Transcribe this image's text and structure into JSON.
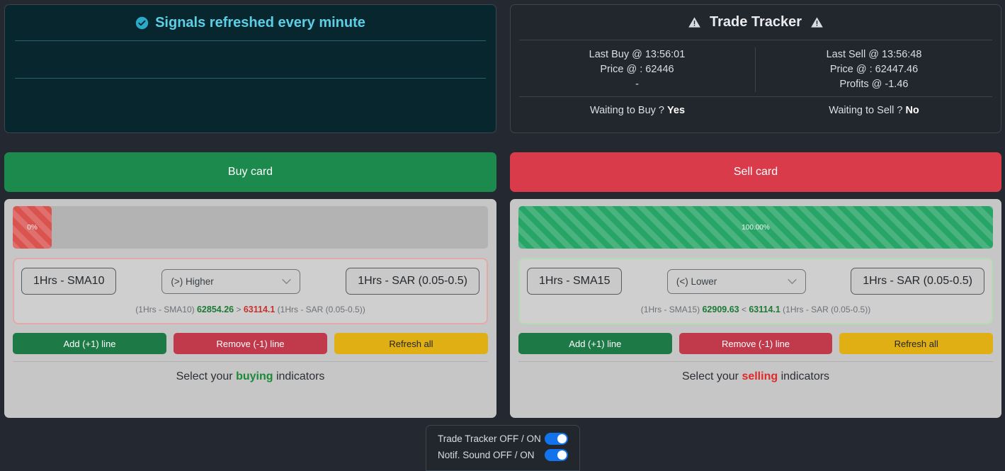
{
  "info_card": {
    "icon": "check-circle-icon",
    "title": "Signals refreshed every minute"
  },
  "trade_tracker": {
    "icon_left": "warning-triangle-icon",
    "icon_right": "warning-triangle-icon",
    "title": "Trade Tracker",
    "buy": {
      "last": "Last Buy @ 13:56:01",
      "price": "Price @ : 62446",
      "profits": "-",
      "waiting_label": "Waiting to Buy ?",
      "waiting_value": "Yes"
    },
    "sell": {
      "last": "Last Sell @ 13:56:48",
      "price": "Price @ : 62447.46",
      "profits": "Profits @ -1.46",
      "waiting_label": "Waiting to Sell ?",
      "waiting_value": "No"
    }
  },
  "buy_card": {
    "banner": "Buy card",
    "progress": {
      "percent_label": "0%",
      "percent_value": 0,
      "color": "#d9534f"
    },
    "indicator": {
      "left_button": "1Hrs - SMA10",
      "comparator": "(>) Higher",
      "right_button": "1Hrs - SAR (0.05-0.5)",
      "values": {
        "left_name": "(1Hrs - SMA10)",
        "left_value": "62854.26",
        "operator": ">",
        "right_value": "63114.1",
        "right_name": "(1Hrs - SAR (0.05-0.5))",
        "left_color": "#1c7a34",
        "right_color": "#c9302c"
      }
    },
    "actions": {
      "add": "Add (+1) line",
      "remove": "Remove (-1) line",
      "refresh": "Refresh all"
    },
    "footer": {
      "prefix": "Select your",
      "highlight": "buying",
      "suffix": "indicators",
      "highlight_color": "#1a8a38"
    }
  },
  "sell_card": {
    "banner": "Sell card",
    "progress": {
      "percent_label": "100.00%",
      "percent_value": 100,
      "color": "#27a567"
    },
    "indicator": {
      "left_button": "1Hrs - SMA15",
      "comparator": "(<) Lower",
      "right_button": "1Hrs - SAR (0.05-0.5)",
      "values": {
        "left_name": "(1Hrs - SMA15)",
        "left_value": "62909.63",
        "operator": "<",
        "right_value": "63114.1",
        "right_name": "(1Hrs - SAR (0.05-0.5))",
        "left_color": "#1c7a34",
        "right_color": "#1c7a34"
      }
    },
    "actions": {
      "add": "Add (+1) line",
      "remove": "Remove (-1) line",
      "refresh": "Refresh all"
    },
    "footer": {
      "prefix": "Select your",
      "highlight": "selling",
      "suffix": "indicators",
      "highlight_color": "#e02a2a"
    }
  },
  "bottom_toggles": [
    {
      "label": "Trade Tracker OFF / ON",
      "state": "on"
    },
    {
      "label": "Notif. Sound OFF / ON",
      "state": "on"
    }
  ]
}
